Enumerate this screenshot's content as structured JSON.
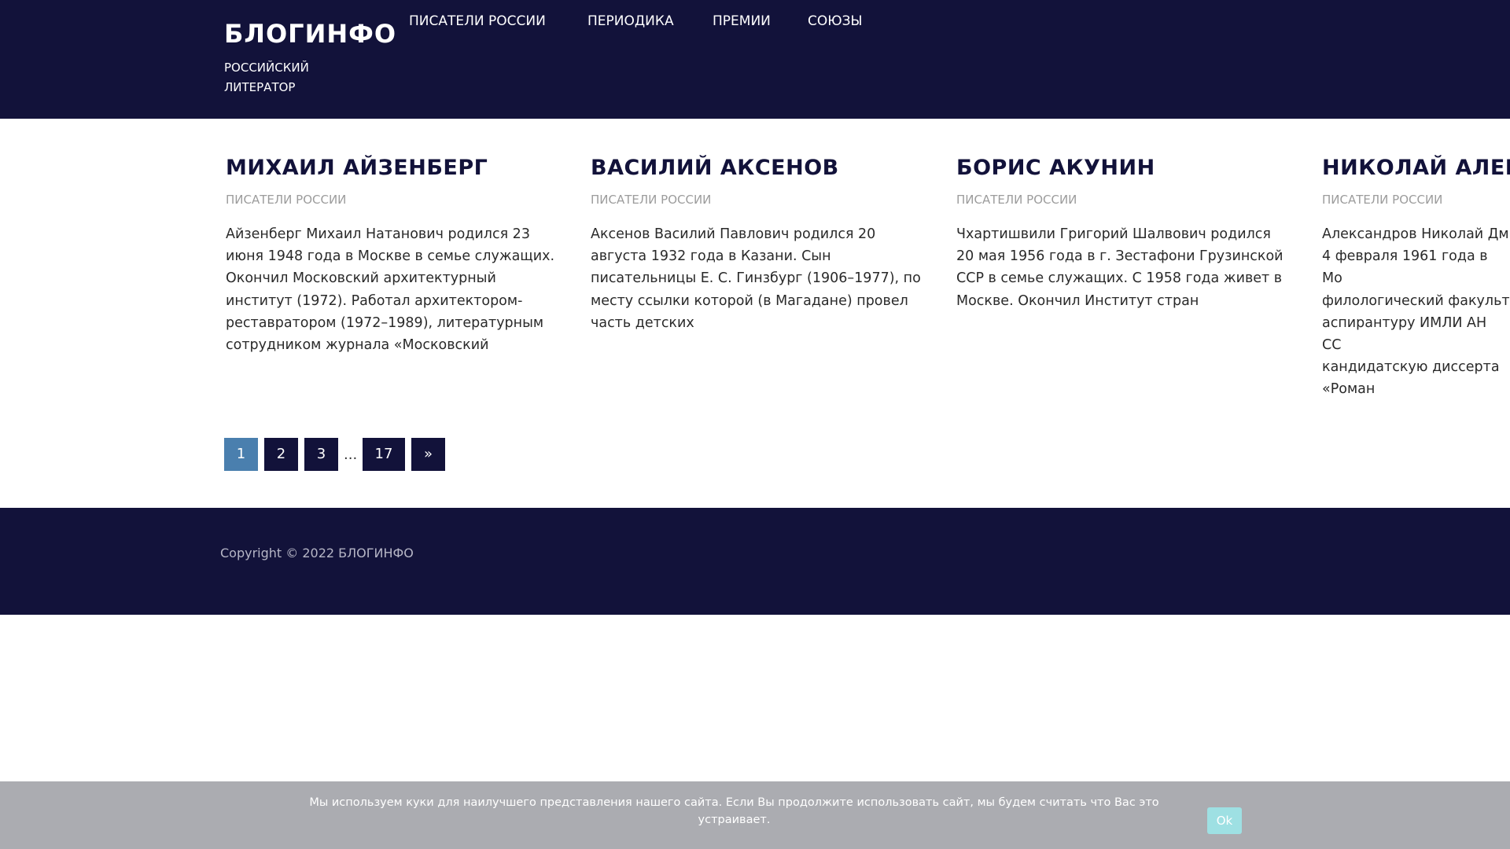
{
  "site": {
    "title": "БЛОГИНФО",
    "tagline": "РОССИЙСКИЙ ЛИТЕРАТОР"
  },
  "nav": [
    "ПИСАТЕЛИ РОССИИ",
    "ПЕРИОДИКА",
    "ПРЕМИИ",
    "СОЮЗЫ"
  ],
  "posts": [
    {
      "title": "МИХАИЛ АЙЗЕНБЕРГ",
      "category": "ПИСАТЕЛИ РОССИИ",
      "excerpt": "Айзенберг Михаил Натанович родился 23 июня 1948 года в Москве в семье служащих. Окончил Московский архитектурный институт (1972). Работал архитектором-реставратором (1972–1989), литературным сотрудником журнала «Московский"
    },
    {
      "title": "ВАСИЛИЙ АКСЕНОВ",
      "category": "ПИСАТЕЛИ РОССИИ",
      "excerpt": "Аксенов Василий Павлович родился 20 августа 1932 года в Казани. Сын писательницы Е. С. Гинзбург (1906–1977), по месту ссылки которой (в Магадане) провел часть детских"
    },
    {
      "title": "БОРИС АКУНИН",
      "category": "ПИСАТЕЛИ РОССИИ",
      "excerpt": "Чхартишвили Григорий Шалвович родился 20 мая 1956 года в г. Зестафони Грузинской ССР в семье служащих. С 1958 года живет в Москве. Окончил Институт стран"
    },
    {
      "title": "НИКОЛАЙ АЛЕК",
      "category": "ПИСАТЕЛИ РОССИИ",
      "excerpt": "Александров Николай Дм 4 февраля 1961 года в Мо филологический факульт аспирантуру ИМЛИ АН СС кандидатскую диссерта «Роман"
    }
  ],
  "pagination": {
    "pages": [
      "1",
      "2",
      "3",
      "17"
    ],
    "current": "1",
    "ellipsis": "...",
    "next": "»"
  },
  "footer": {
    "copyright": "Copyright © 2022 БЛОГИНФО"
  },
  "cookie": {
    "text": "Мы используем куки для наилучшего представления нашего сайта. Если Вы продолжите использовать сайт, мы будем считать что Вас это устраивает.",
    "button": "Ok"
  },
  "colors": {
    "header_bg": "#12123a",
    "accent_current_page": "#4a7fae",
    "cookie_bg": "#abacb1",
    "cookie_button": "#9ee0e3"
  }
}
